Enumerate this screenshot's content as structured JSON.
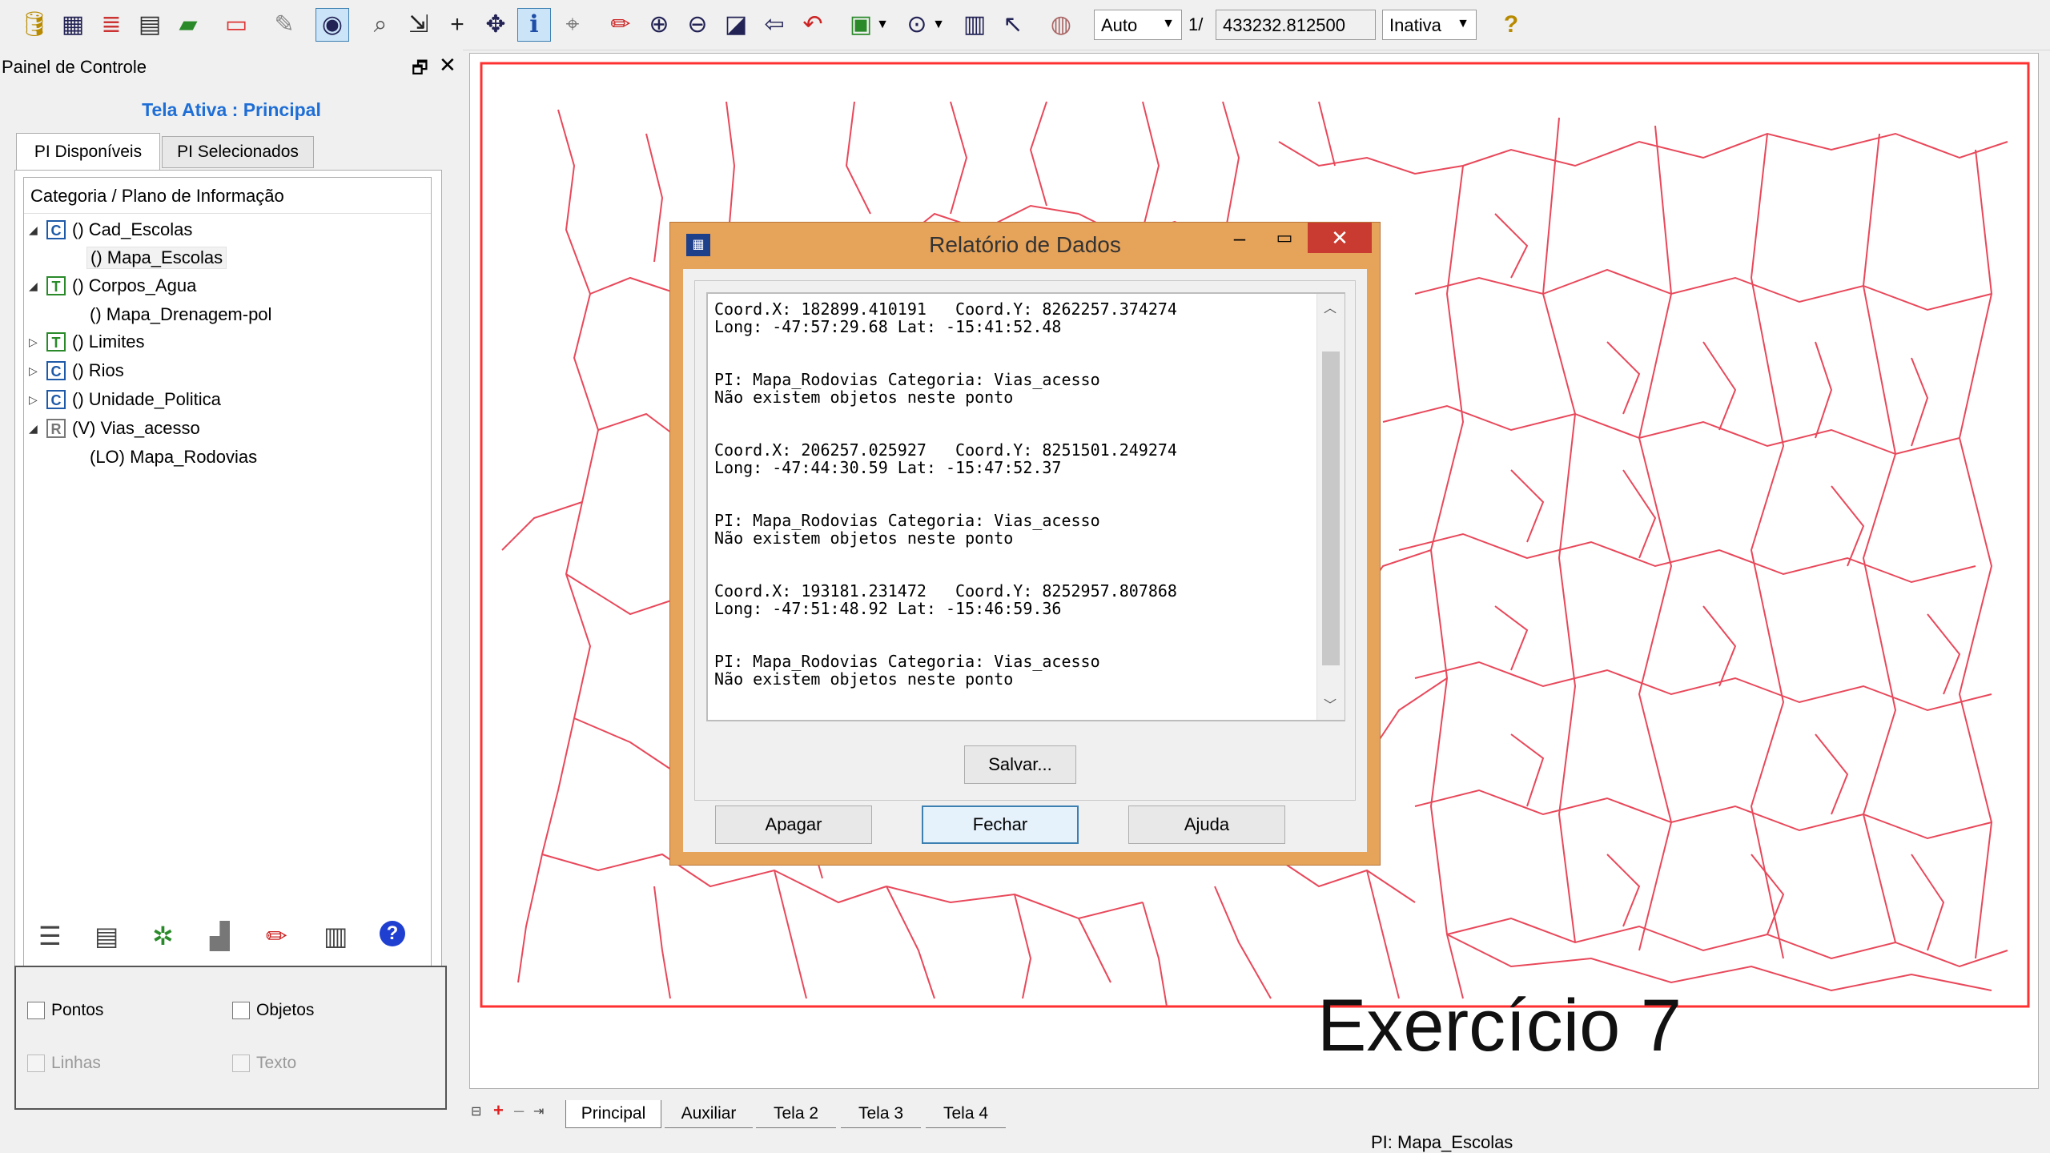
{
  "toolbar": {
    "scale_mode": "Auto",
    "scale_prefix": "1/",
    "scale_value": "433232.812500",
    "state": "Inativa",
    "icons": [
      "database-icon",
      "view-icon",
      "layers-icon",
      "table-icon",
      "eraser-icon",
      "frame-icon",
      "pin-icon",
      "info-tool-icon",
      "magnifier-icon",
      "arrow-down-right-icon",
      "plus-icon",
      "pan-icon",
      "identify-icon",
      "select-icon",
      "pencil-icon",
      "zoom-in-icon",
      "zoom-out-icon",
      "zoom-area-icon",
      "back-icon",
      "undo-icon",
      "draw-mode-icon",
      "zoom-dropdown-icon",
      "raster-icon",
      "cursor-icon",
      "palette-icon",
      "help-icon"
    ]
  },
  "panel": {
    "title": "Painel de Controle",
    "active_screen": "Tela Ativa : Principal",
    "tabs": [
      "PI Disponíveis",
      "PI Selecionados"
    ],
    "tree_header": "Categoria / Plano de Informação",
    "tree": [
      {
        "badge": "C",
        "label": "() Cad_Escolas",
        "expander": "◢",
        "child": "() Mapa_Escolas"
      },
      {
        "badge": "T",
        "label": "() Corpos_Agua",
        "expander": "◢",
        "child": "() Mapa_Drenagem-pol"
      },
      {
        "badge": "T",
        "label": "() Limites",
        "expander": "▷"
      },
      {
        "badge": "C",
        "label": "() Rios",
        "expander": "▷"
      },
      {
        "badge": "C",
        "label": "() Unidade_Politica",
        "expander": "▷"
      },
      {
        "badge": "R",
        "label": "(V) Vias_acesso",
        "expander": "◢",
        "child": "(LO) Mapa_Rodovias"
      }
    ],
    "tool_icons": [
      "list-icon",
      "properties-icon",
      "visualize-icon",
      "chart-icon",
      "edit-icon",
      "legend-icon",
      "help-icon"
    ],
    "checkboxes": {
      "pontos": "Pontos",
      "objetos": "Objetos",
      "linhas": "Linhas",
      "texto": "Texto"
    }
  },
  "dialog": {
    "title": "Relatório de Dados",
    "report_lines": [
      "Coord.X: 182899.410191   Coord.Y: 8262257.374274",
      "Long: -47:57:29.68 Lat: -15:41:52.48",
      "",
      "",
      "PI: Mapa_Rodovias Categoria: Vias_acesso",
      "Não existem objetos neste ponto",
      "",
      "",
      "Coord.X: 206257.025927   Coord.Y: 8251501.249274",
      "Long: -47:44:30.59 Lat: -15:47:52.37",
      "",
      "",
      "PI: Mapa_Rodovias Categoria: Vias_acesso",
      "Não existem objetos neste ponto",
      "",
      "",
      "Coord.X: 193181.231472   Coord.Y: 8252957.807868",
      "Long: -47:51:48.92 Lat: -15:46:59.36",
      "",
      "",
      "PI: Mapa_Rodovias Categoria: Vias_acesso",
      "Não existem objetos neste ponto"
    ],
    "save_label": "Salvar...",
    "clear_label": "Apagar",
    "close_label": "Fechar",
    "help_label": "Ajuda",
    "minimize": "–",
    "maximize": "▭",
    "close_x": "✕"
  },
  "map": {
    "overlay_text": "Exercício 7",
    "road_color": "#e8485a",
    "border_color": "#ff3030"
  },
  "bottom_tabs": [
    "Principal",
    "Auxiliar",
    "Tela 2",
    "Tela 3",
    "Tela 4"
  ],
  "status": {
    "pi": "PI: Mapa_Escolas"
  }
}
